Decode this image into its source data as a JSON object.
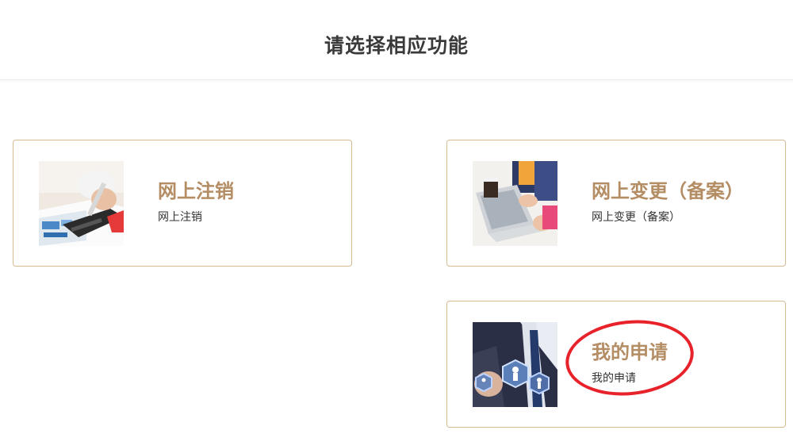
{
  "header": {
    "title": "请选择相应功能"
  },
  "cards": [
    {
      "title": "网上注销",
      "subtitle": "网上注销",
      "icon": "document-chart-icon"
    },
    {
      "title": "网上变更（备案）",
      "subtitle": "网上变更（备案）",
      "icon": "laptop-coffee-icon"
    },
    {
      "title": "我的申请",
      "subtitle": "我的申请",
      "icon": "network-people-icon"
    }
  ],
  "colors": {
    "card_border": "#d6bb93",
    "card_title": "#b48d64",
    "annotation": "#e8222a"
  }
}
